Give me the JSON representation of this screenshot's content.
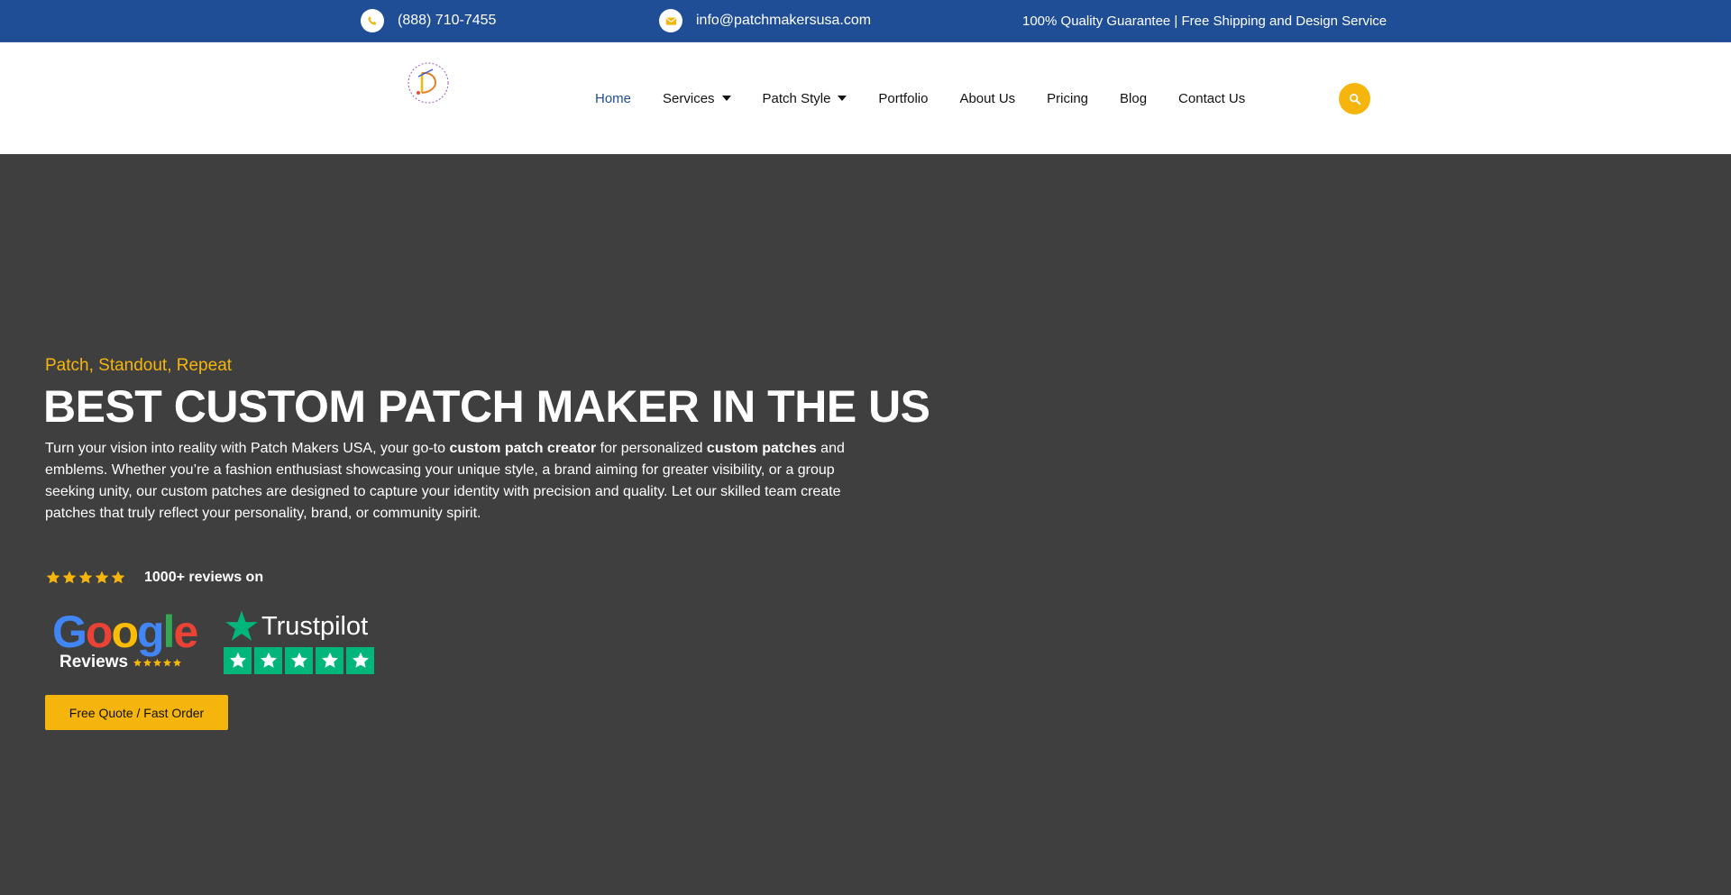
{
  "topbar": {
    "phone": "(888) 710-7455",
    "email": "info@patchmakersusa.com",
    "guarantee": "100% Quality Guarantee | Free Shipping and Design Service",
    "phone_icon": "phone-icon",
    "email_icon": "envelope-icon"
  },
  "header": {
    "logo_icon": "brand-logo",
    "nav": [
      {
        "label": "Home",
        "active": true
      },
      {
        "label": "Services",
        "dropdown": true
      },
      {
        "label": "Patch Style",
        "dropdown": true
      },
      {
        "label": "Portfolio"
      },
      {
        "label": "About Us"
      },
      {
        "label": "Pricing"
      },
      {
        "label": "Blog"
      },
      {
        "label": "Contact Us"
      }
    ],
    "search_icon": "search-icon"
  },
  "hero": {
    "tagline": "Patch, Standout, Repeat",
    "title": "BEST CUSTOM PATCH MAKER IN THE US",
    "desc_1": "Turn your vision into reality with Patch Makers USA, your go-to ",
    "desc_bold_1": "custom patch creator",
    "desc_2": " for personalized ",
    "desc_bold_2": "custom patches",
    "desc_3": " and emblems. Whether you’re a fashion enthusiast showcasing your unique style, a brand aiming for greater visibility, or a group seeking unity, our custom patches are designed to capture your identity with precision and quality. Let our skilled team create patches that truly reflect your personality, brand, or community spirit.",
    "rating_stars": 5,
    "reviews_text": "1000+ reviews on",
    "google_word": {
      "g1": "G",
      "o1": "o",
      "o2": "o",
      "g2": "g",
      "l": "l",
      "e": "e"
    },
    "google_sub": "Reviews",
    "trustpilot": "Trustpilot",
    "cta_label": "Free Quote / Fast Order"
  },
  "colors": {
    "topbar": "#1f4e96",
    "accent": "#f6b50d",
    "hero_bg": "#3f3f3f",
    "trustpilot_green": "#00b67a"
  }
}
